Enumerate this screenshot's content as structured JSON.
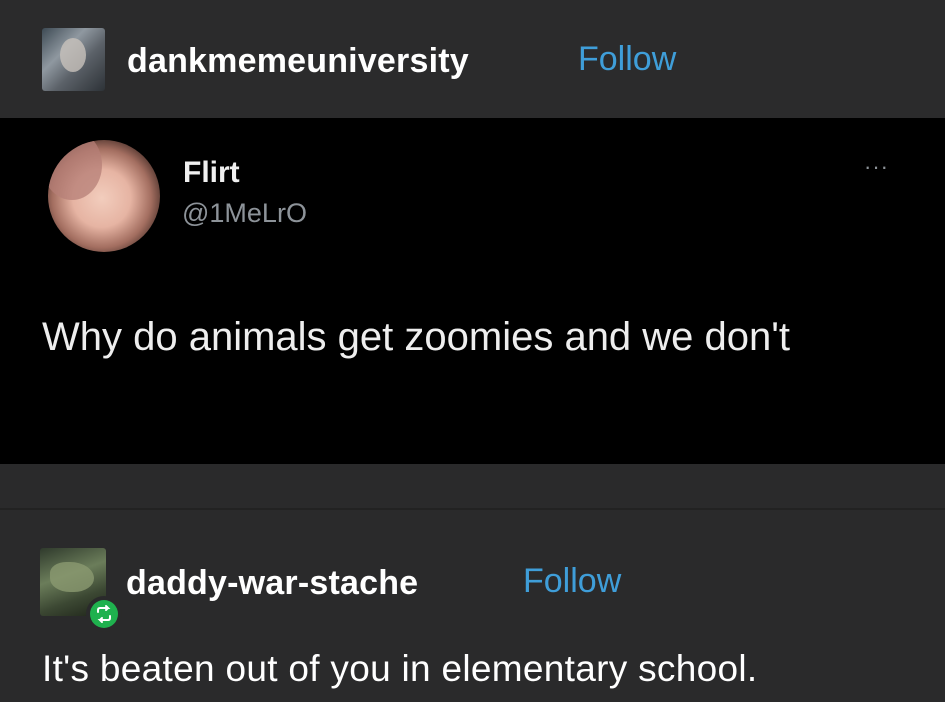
{
  "post": {
    "author": "dankmemeuniversity",
    "follow_label": "Follow"
  },
  "tweet": {
    "display_name": "Flirt",
    "handle": "@1MeLrO",
    "more_label": "···",
    "text": "Why do animals get zoomies and we don't"
  },
  "reply": {
    "author": "daddy-war-stache",
    "follow_label": "Follow",
    "text": "It's beaten out of you in elementary school."
  },
  "colors": {
    "background": "#2a2a2b",
    "tweet_background": "#000000",
    "follow": "#3f9ed9",
    "reblog_badge": "#1fb14e"
  }
}
